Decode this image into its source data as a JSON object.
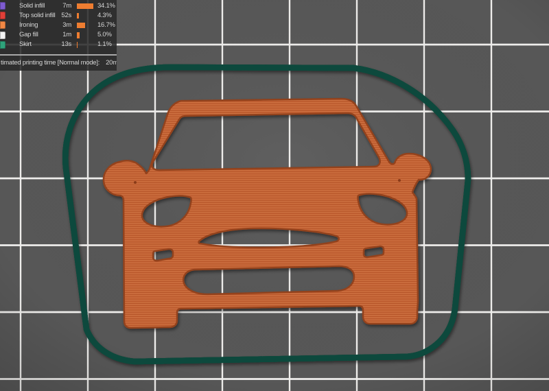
{
  "scene": {
    "bed_color": "#575757",
    "bed_hole_shade": "#494949",
    "grid_color": "#efeeec",
    "panel_color": "rgba(42,42,42,0.88)",
    "legend_text_color": "#d6d6d6",
    "bar_color": "#ee7d31",
    "model_color_base": "#b8572b",
    "model_color_light": "#cd7040",
    "model_outline_color": "#93421e",
    "skirt_color_dark": "#0c4a3c",
    "skirt_color_mid": "#13735b",
    "skirt_color_light": "#1d9b78"
  },
  "legend": {
    "rows": [
      {
        "label": "Solid infill",
        "time": "7m",
        "percent": "34.1%",
        "pct": 34.1,
        "swatch": "#7e5bd0",
        "swatch_name": "solid-infill-color"
      },
      {
        "label": "Top solid infill",
        "time": "52s",
        "percent": "4.3%",
        "pct": 4.3,
        "swatch": "#e14038",
        "swatch_name": "top-solid-infill-color"
      },
      {
        "label": "Ironing",
        "time": "3m",
        "percent": "16.7%",
        "pct": 16.7,
        "swatch": "#f28845",
        "swatch_name": "ironing-color"
      },
      {
        "label": "Gap fill",
        "time": "1m",
        "percent": "5.0%",
        "pct": 5.0,
        "swatch": "#f5f5f5",
        "swatch_name": "gap-fill-color"
      },
      {
        "label": "Skirt",
        "time": "13s",
        "percent": "1.1%",
        "pct": 1.1,
        "swatch": "#2fa37b",
        "swatch_name": "skirt-color"
      }
    ],
    "estimated_label": "timated printing time [Normal mode]:",
    "estimated_value": "20m"
  }
}
